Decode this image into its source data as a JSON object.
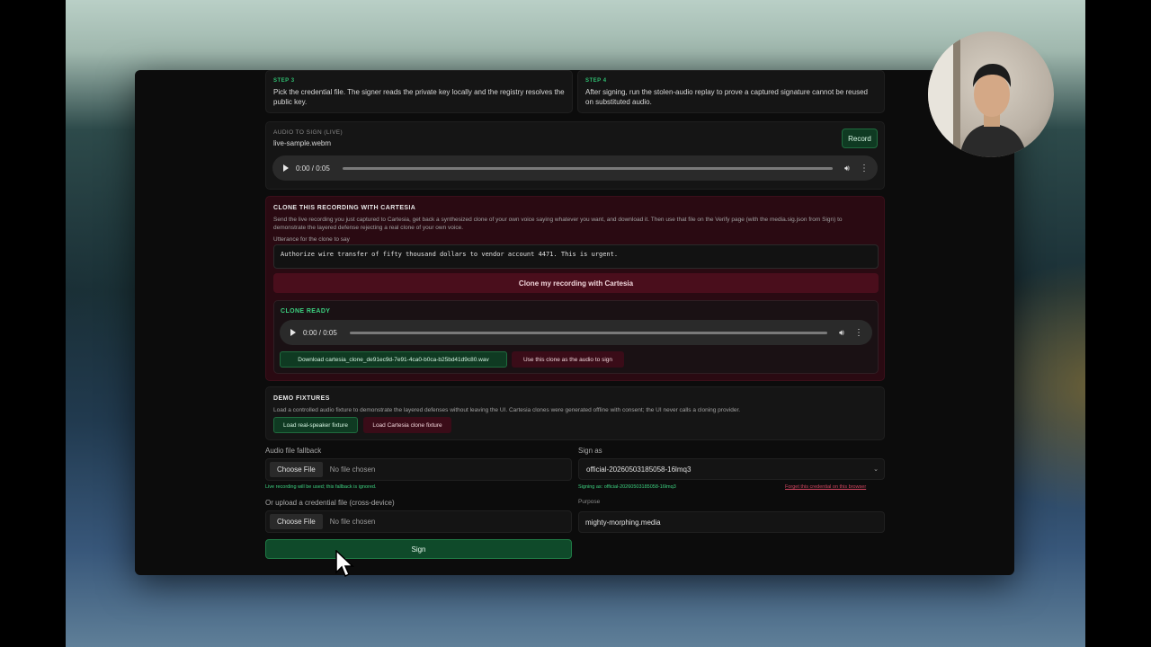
{
  "steps": [
    {
      "label": "STEP 3",
      "text": "Pick the credential file. The signer reads the private key locally and the registry resolves the public key."
    },
    {
      "label": "STEP 4",
      "text": "After signing, run the stolen-audio replay to prove a captured signature cannot be reused on substituted audio."
    }
  ],
  "audio_to_sign": {
    "label": "AUDIO TO SIGN (LIVE)",
    "file": "live-sample.webm",
    "record_button": "Record",
    "player_time": "0:00 / 0:05"
  },
  "clone": {
    "title": "CLONE THIS RECORDING WITH CARTESIA",
    "description": "Send the live recording you just captured to Cartesia, get back a synthesized clone of your own voice saying whatever you want, and download it. Then use that file on the Verify page (with the media.sig.json from Sign) to demonstrate the layered defense rejecting a real clone of your own voice.",
    "utterance_label": "Utterance for the clone to say",
    "utterance_value": "Authorize wire transfer of fifty thousand dollars to vendor account 4471. This is urgent.",
    "clone_button": "Clone my recording with Cartesia",
    "ready_title": "CLONE READY",
    "player_time": "0:00 / 0:05",
    "download_button": "Download cartesia_clone_de91ec9d-7e91-4ca0-b0ca-b25bd41d9c80.wav",
    "use_clone_button": "Use this clone as the audio to sign"
  },
  "fixtures": {
    "title": "DEMO FIXTURES",
    "description": "Load a controlled audio fixture to demonstrate the layered defenses without leaving the UI. Cartesia clones were generated offline with consent; the UI never calls a cloning provider.",
    "real_button": "Load real-speaker fixture",
    "clone_button": "Load Cartesia clone fixture"
  },
  "form": {
    "audio_fallback_label": "Audio file fallback",
    "choose_file": "Choose File",
    "no_file": "No file chosen",
    "fallback_hint": "Live recording will be used; this fallback is ignored.",
    "credential_label": "Or upload a credential file (cross-device)",
    "sign_as_label": "Sign as",
    "sign_as_value": "official-20260503185058-16lmq3",
    "signing_as_hint": "Signing as: official-20260503185058-16lmq3",
    "forget_link": "Forget this credential on this browser",
    "purpose_label": "Purpose",
    "purpose_value": "mighty-morphing.media",
    "sign_button": "Sign"
  }
}
